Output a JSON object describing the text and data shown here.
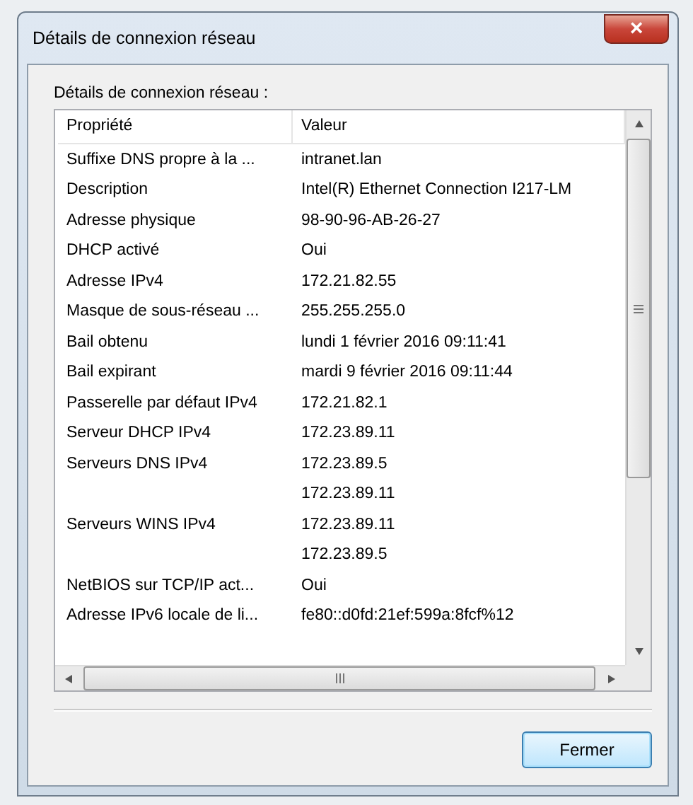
{
  "window": {
    "title": "Détails de connexion réseau",
    "close": "×"
  },
  "list_label": "Détails de connexion réseau :",
  "table": {
    "columns": [
      "Propriété",
      "Valeur"
    ],
    "rows": [
      {
        "property": "Suffixe DNS propre à la ...",
        "value": "intranet.lan"
      },
      {
        "property": "Description",
        "value": "Intel(R) Ethernet Connection I217-LM"
      },
      {
        "property": "Adresse physique",
        "value": "98-90-96-AB-26-27"
      },
      {
        "property": "DHCP activé",
        "value": "Oui"
      },
      {
        "property": "Adresse IPv4",
        "value": "172.21.82.55"
      },
      {
        "property": "Masque de sous-réseau ...",
        "value": "255.255.255.0"
      },
      {
        "property": "Bail obtenu",
        "value": "lundi 1 février 2016 09:11:41"
      },
      {
        "property": "Bail expirant",
        "value": "mardi 9 février 2016 09:11:44"
      },
      {
        "property": "Passerelle par défaut IPv4",
        "value": "172.21.82.1"
      },
      {
        "property": "Serveur DHCP IPv4",
        "value": "172.23.89.11"
      },
      {
        "property": "Serveurs DNS IPv4",
        "value": "172.23.89.5"
      },
      {
        "property": "",
        "value": "172.23.89.11"
      },
      {
        "property": "Serveurs WINS IPv4",
        "value": "172.23.89.11"
      },
      {
        "property": "",
        "value": "172.23.89.5"
      },
      {
        "property": "NetBIOS sur TCP/IP act...",
        "value": "Oui"
      },
      {
        "property": "Adresse IPv6 locale de li...",
        "value": "fe80::d0fd:21ef:599a:8fcf%12"
      }
    ]
  },
  "buttons": [
    "Fermer"
  ]
}
